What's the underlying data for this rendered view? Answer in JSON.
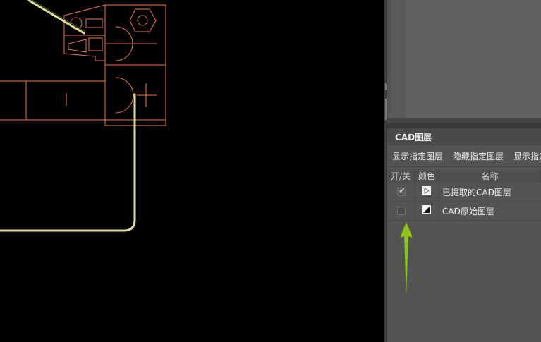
{
  "layers_panel": {
    "title": "CAD图层",
    "toolbar": {
      "show_selected": "显示指定图层",
      "hide_selected": "隐藏指定图层",
      "show_all": "显示指定"
    },
    "columns": {
      "toggle": "开/关",
      "color": "颜色",
      "name": "名称"
    },
    "layers": [
      {
        "name": "已提取的CAD图层",
        "visible": true,
        "color_icon": "play-outline-icon"
      },
      {
        "name": "CAD原始图层",
        "visible": false,
        "color_icon": "triangle-filled-icon"
      }
    ],
    "check_mark": "✔"
  },
  "colors": {
    "cad_lines": "#e8794a",
    "selection_path": "#dcdca0",
    "annotation_arrow": "#8ec31a",
    "panel_bg": "#535353"
  }
}
